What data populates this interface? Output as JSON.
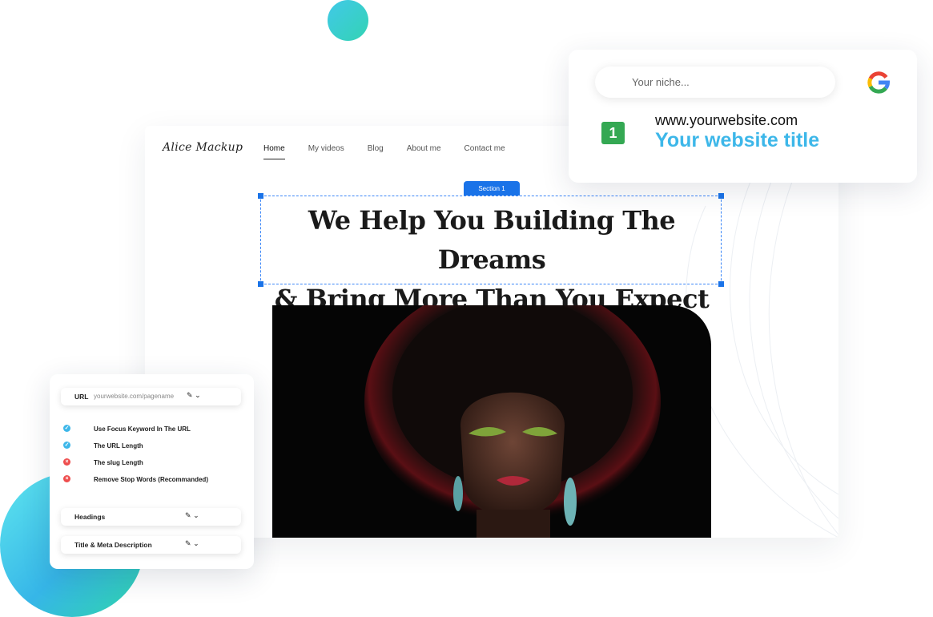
{
  "site": {
    "logo": "Alice Mackup",
    "nav": [
      "Home",
      "My videos",
      "Blog",
      "About me",
      "Contact me"
    ],
    "active_nav": "Home",
    "section_tag": "Section 1",
    "headline_line1": "We Help You Building The Dreams",
    "headline_line2": "& Bring More Than You Expect"
  },
  "serp": {
    "search_placeholder": "Your niche...",
    "rank": "1",
    "url": "www.yourwebsite.com",
    "title": "Your website title",
    "icon": "google-g-icon"
  },
  "seo_panel": {
    "url_label": "URL",
    "url_value": "yourwebsite.com/pagename",
    "checks": [
      {
        "label": "Use Focus Keyword In The URL",
        "status": "pass"
      },
      {
        "label": "The URL Length",
        "status": "pass"
      },
      {
        "label": "The slug Length",
        "status": "fail"
      },
      {
        "label": "Remove Stop Words (Recommanded)",
        "status": "fail"
      }
    ],
    "headings_label": "Headings",
    "meta_label": "Title & Meta Description"
  },
  "colors": {
    "accent_blue": "#1a73e8",
    "serp_title": "#3db7e9",
    "rank_green": "#34a853",
    "pass": "#3db7e9",
    "fail": "#ee4d4d"
  }
}
